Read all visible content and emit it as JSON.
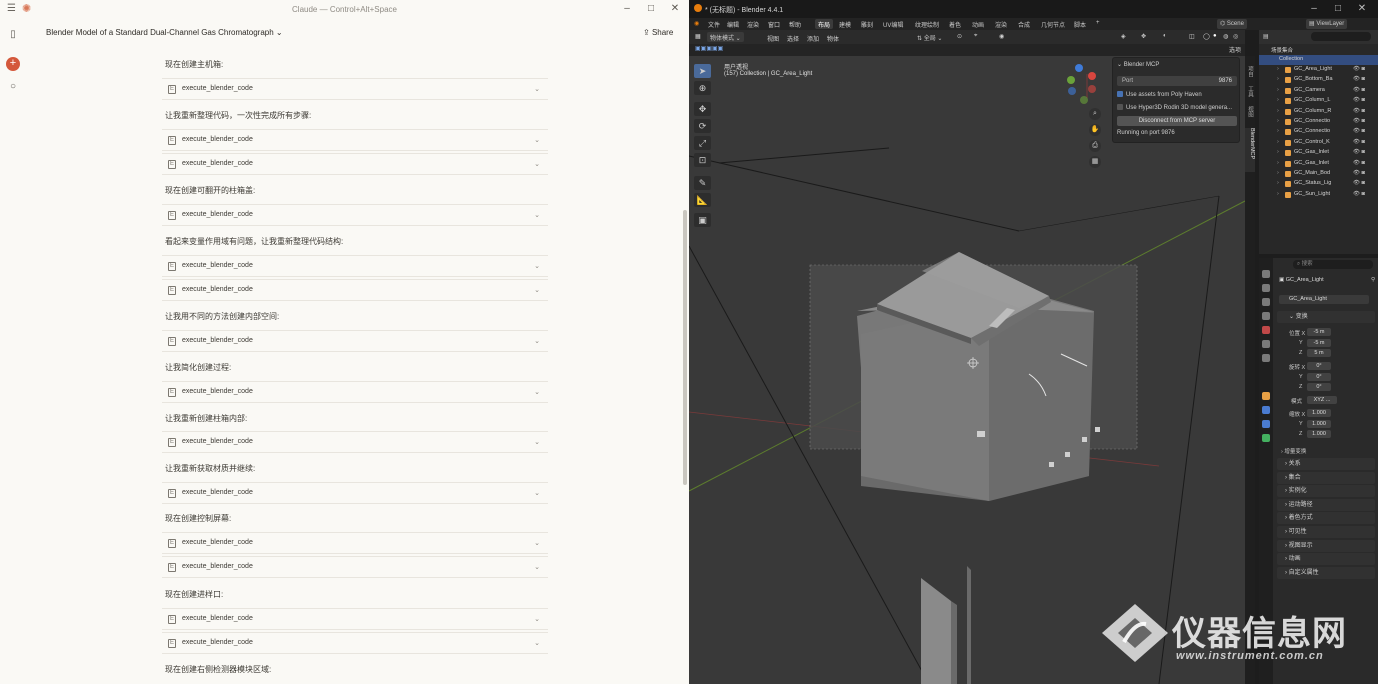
{
  "claude": {
    "titlebar": {
      "center": "Claude — Control+Alt+Space",
      "menu_icon": "hamburger-icon",
      "logo_icon": "claude-asterisk-icon"
    },
    "chat_title": "Blender Model of a Standard Dual-Channel Gas Chromatograph",
    "share_label": "Share",
    "messages": [
      {
        "type": "text",
        "text": "现在创建主机箱:"
      },
      {
        "type": "tool",
        "label": "execute_blender_code"
      },
      {
        "type": "text",
        "text": "让我重新整理代码，一次性完成所有步骤:"
      },
      {
        "type": "tool",
        "label": "execute_blender_code"
      },
      {
        "type": "tool",
        "label": "execute_blender_code"
      },
      {
        "type": "text",
        "text": "现在创建可翻开的柱箱盖:"
      },
      {
        "type": "tool",
        "label": "execute_blender_code"
      },
      {
        "type": "text",
        "text": "看起来变量作用域有问题，让我重新整理代码结构:"
      },
      {
        "type": "tool",
        "label": "execute_blender_code"
      },
      {
        "type": "tool",
        "label": "execute_blender_code"
      },
      {
        "type": "text",
        "text": "让我用不同的方法创建内部空间:"
      },
      {
        "type": "tool",
        "label": "execute_blender_code"
      },
      {
        "type": "text",
        "text": "让我简化创建过程:"
      },
      {
        "type": "tool",
        "label": "execute_blender_code"
      },
      {
        "type": "text",
        "text": "让我重新创建柱箱内部:"
      },
      {
        "type": "tool",
        "label": "execute_blender_code"
      },
      {
        "type": "text",
        "text": "让我重新获取材质并继续:"
      },
      {
        "type": "tool",
        "label": "execute_blender_code"
      },
      {
        "type": "text",
        "text": "现在创建控制屏幕:"
      },
      {
        "type": "tool",
        "label": "execute_blender_code"
      },
      {
        "type": "tool",
        "label": "execute_blender_code"
      },
      {
        "type": "text",
        "text": "现在创建进样口:"
      },
      {
        "type": "tool",
        "label": "execute_blender_code"
      },
      {
        "type": "tool",
        "label": "execute_blender_code"
      },
      {
        "type": "text",
        "text": "现在创建右侧检测器模块区域:"
      }
    ]
  },
  "blender": {
    "title": "* (无标题) - Blender 4.4.1",
    "menus": [
      "文件",
      "编辑",
      "渲染",
      "窗口",
      "帮助"
    ],
    "workspaces": [
      "布局",
      "建模",
      "雕刻",
      "UV编辑",
      "纹理绘制",
      "着色",
      "动画",
      "渲染",
      "合成",
      "几何节点",
      "脚本"
    ],
    "active_workspace": "布局",
    "scene_label": "Scene",
    "viewlayer_label": "ViewLayer",
    "viewport_header": {
      "mode": "物体模式",
      "items": [
        "视图",
        "选择",
        "添加",
        "物体"
      ],
      "transform": "全局"
    },
    "overlay_text": {
      "line1": "用户透视",
      "line2": "(157) Collection | GC_Area_Light"
    },
    "mcp_panel": {
      "header": "Blender MCP",
      "port_label": "Port",
      "port_value": "9876",
      "polyhaven_label": "Use assets from Poly Haven",
      "polyhaven_checked": true,
      "hyper3d_label": "Use Hyper3D Rodin 3D model genera...",
      "hyper3d_checked": false,
      "disconnect_label": "Disconnect from MCP server",
      "status": "Running on port 9876"
    },
    "n_tabs": [
      "项目",
      "工具",
      "视图",
      "BlenderMCP"
    ],
    "outliner": {
      "title": "场景集合",
      "collection": "Collection",
      "items": [
        "GC_Area_Light",
        "GC_Bottom_Ba",
        "GC_Camera",
        "GC_Column_L",
        "GC_Column_R",
        "GC_Connectio",
        "GC_Connectio",
        "GC_Control_K",
        "GC_Gas_Inlet",
        "GC_Gas_Inlet",
        "GC_Main_Bod",
        "GC_Status_Lig",
        "GC_Sun_Light"
      ]
    },
    "properties": {
      "search_placeholder": "搜索",
      "object_name": "GC_Area_Light",
      "data_name": "GC_Area_Light",
      "transform_label": "变换",
      "location_label": "位置 X",
      "location": [
        "-5 m",
        "-5 m",
        "5 m"
      ],
      "rotation_label": "旋转 X",
      "rotation": [
        "0°",
        "0°",
        "0°"
      ],
      "mode_label": "模式",
      "mode_value": "XYZ ...",
      "scale_label": "缩放 X",
      "scale": [
        "1.000",
        "1.000",
        "1.000"
      ],
      "delta_label": "增量变换",
      "sections": [
        "关系",
        "集合",
        "实例化",
        "运动路径",
        "着色方式",
        "可见性",
        "视图显示",
        "动画",
        "自定义属性"
      ]
    }
  },
  "watermark": {
    "brand": "仪器信息网",
    "url": "www.instrument.com.cn"
  }
}
